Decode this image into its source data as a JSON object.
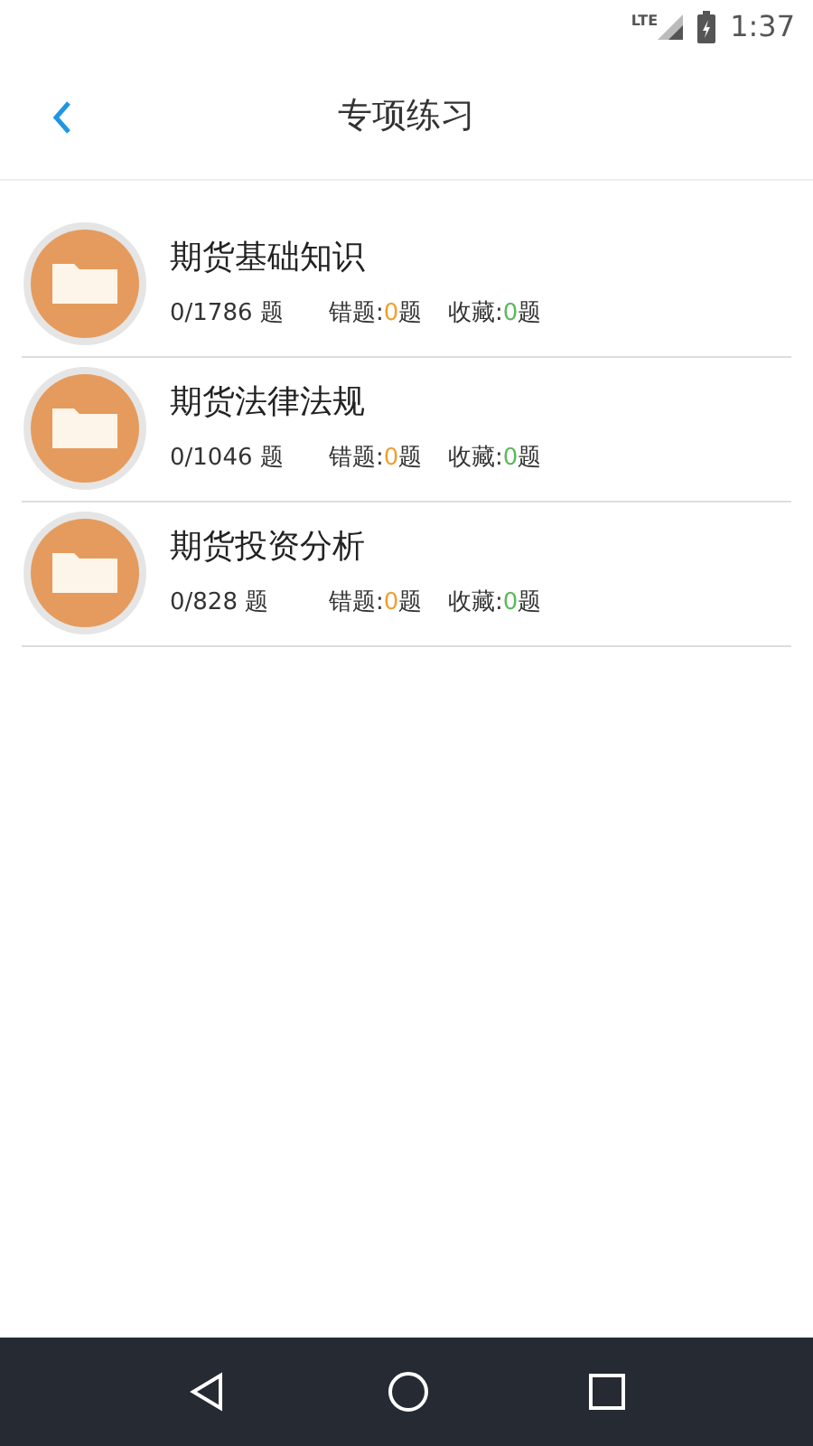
{
  "status_bar": {
    "network": "LTE",
    "time": "1:37"
  },
  "header": {
    "title": "专项练习"
  },
  "items": [
    {
      "title": "期货基础知识",
      "progress": "0/1786 题",
      "wrong_label": "错题:",
      "wrong_count": "0",
      "wrong_unit": "题",
      "fav_label": "收藏:",
      "fav_count": "0",
      "fav_unit": "题"
    },
    {
      "title": "期货法律法规",
      "progress": "0/1046 题",
      "wrong_label": "错题:",
      "wrong_count": "0",
      "wrong_unit": "题",
      "fav_label": "收藏:",
      "fav_count": "0",
      "fav_unit": "题"
    },
    {
      "title": "期货投资分析",
      "progress": "0/828 题",
      "wrong_label": "错题:",
      "wrong_count": "0",
      "wrong_unit": "题",
      "fav_label": "收藏:",
      "fav_count": "0",
      "fav_unit": "题"
    }
  ]
}
